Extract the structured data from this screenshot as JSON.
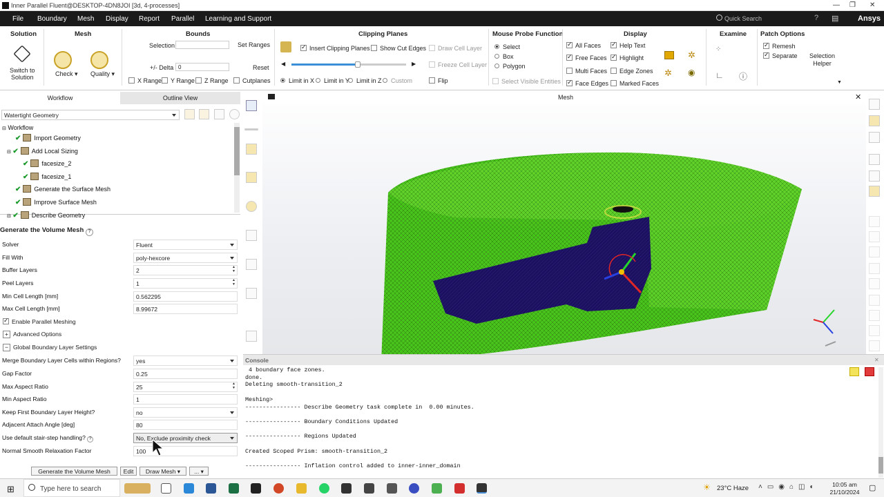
{
  "window": {
    "title": "Inner Parallel Fluent@DESKTOP-4DN8JOI  [3d, 4-processes]"
  },
  "menubar": {
    "items": [
      "File",
      "Boundary",
      "Mesh",
      "Display",
      "Report",
      "Parallel",
      "Learning and Support"
    ],
    "search_placeholder": "Quick Search",
    "brand": "Ansys"
  },
  "ribbon": {
    "solution": {
      "title": "Solution",
      "switch_label": "Switch to\nSolution"
    },
    "mesh": {
      "title": "Mesh",
      "check": "Check",
      "quality": "Quality"
    },
    "bounds": {
      "title": "Bounds",
      "selection": "Selection",
      "set_ranges": "Set Ranges",
      "delta_label": "+/- Delta",
      "delta_value": "0",
      "reset": "Reset",
      "x_range": "X Range",
      "y_range": "Y Range",
      "z_range": "Z Range",
      "cutplanes": "Cutplanes"
    },
    "clipping": {
      "title": "Clipping Planes",
      "insert": "Insert Clipping Planes",
      "show_cut_edges": "Show Cut Edges",
      "draw_cell_layer": "Draw Cell Layer",
      "freeze_cell_layer": "Freeze Cell Layer",
      "limit_x": "Limit in X",
      "limit_y": "Limit in Y",
      "limit_z": "Limit in Z",
      "custom": "Custom",
      "flip": "Flip",
      "slider_pct": 58
    },
    "probe": {
      "title": "Mouse Probe Function",
      "select": "Select",
      "box": "Box",
      "polygon": "Polygon",
      "select_visible": "Select Visible Entities"
    },
    "display": {
      "title": "Display",
      "all_faces": "All Faces",
      "free_faces": "Free Faces",
      "multi_faces": "Multi Faces",
      "face_edges": "Face Edges",
      "help_text": "Help Text",
      "highlight": "Highlight",
      "edge_zones": "Edge Zones",
      "marked_faces": "Marked Faces"
    },
    "examine": {
      "title": "Examine"
    },
    "patch": {
      "title": "Patch Options",
      "remesh": "Remesh",
      "separate": "Separate",
      "selection_helper": "Selection\nHelper"
    }
  },
  "left": {
    "tabs": [
      "Workflow",
      "Outline View"
    ],
    "workflow_type": "Watertight Geometry",
    "tree": {
      "root": "Workflow",
      "items": [
        "Import Geometry",
        "Add Local Sizing",
        "facesize_2",
        "facesize_1",
        "Generate the Surface Mesh",
        "Improve Surface Mesh",
        "Describe Geometry"
      ]
    },
    "task_title": "Generate the Volume Mesh",
    "fields": [
      {
        "label": "Solver",
        "value": "Fluent"
      },
      {
        "label": "Fill With",
        "value": "poly-hexcore"
      },
      {
        "label": "Buffer Layers",
        "value": "2"
      },
      {
        "label": "Peel Layers",
        "value": "1"
      },
      {
        "label": "Min Cell Length [mm]",
        "value": "0.562295"
      },
      {
        "label": "Max Cell Length [mm]",
        "value": "8.99672"
      }
    ],
    "enable_parallel": "Enable Parallel Meshing",
    "advanced_options": "Advanced Options",
    "global_bl": "Global Boundary Layer Settings",
    "bl_fields": [
      {
        "label": "Merge Boundary Layer Cells within Regions?",
        "value": "yes"
      },
      {
        "label": "Gap Factor",
        "value": "0.25"
      },
      {
        "label": "Max Aspect Ratio",
        "value": "25"
      },
      {
        "label": "Min Aspect Ratio",
        "value": "1"
      },
      {
        "label": "Keep First Boundary Layer Height?",
        "value": "no"
      },
      {
        "label": "Adjacent Attach Angle [deg]",
        "value": "80"
      },
      {
        "label": "Use default stair-step handling?",
        "value": "No, Exclude proximity check"
      },
      {
        "label": "Normal Smooth Relaxation Factor",
        "value": "100"
      }
    ],
    "buttons": {
      "generate": "Generate the Volume Mesh",
      "edit": "Edit",
      "draw": "Draw Mesh",
      "more": "..."
    }
  },
  "viewport": {
    "title": "Mesh"
  },
  "console": {
    "title": "Console",
    "lines": [
      " 4 boundary face zones.",
      "done.",
      "Deleting smooth-transition_2",
      "",
      "Meshing>",
      "---------------- Describe Geometry task complete in  0.00 minutes.",
      "",
      "---------------- Boundary Conditions Updated",
      "",
      "---------------- Regions Updated",
      "",
      "Created Scoped Prism: smooth-transition_2",
      "",
      "---------------- Inflation control added to inner-inner_domain"
    ]
  },
  "taskbar": {
    "search_placeholder": "Type here to search",
    "weather": "23°C  Haze",
    "time": "10:05 am",
    "date": "21/10/2024"
  },
  "colors": {
    "mesh_green": "#5fd12a",
    "mesh_navy": "#1c1060",
    "menubar": "#1a1a1a"
  }
}
